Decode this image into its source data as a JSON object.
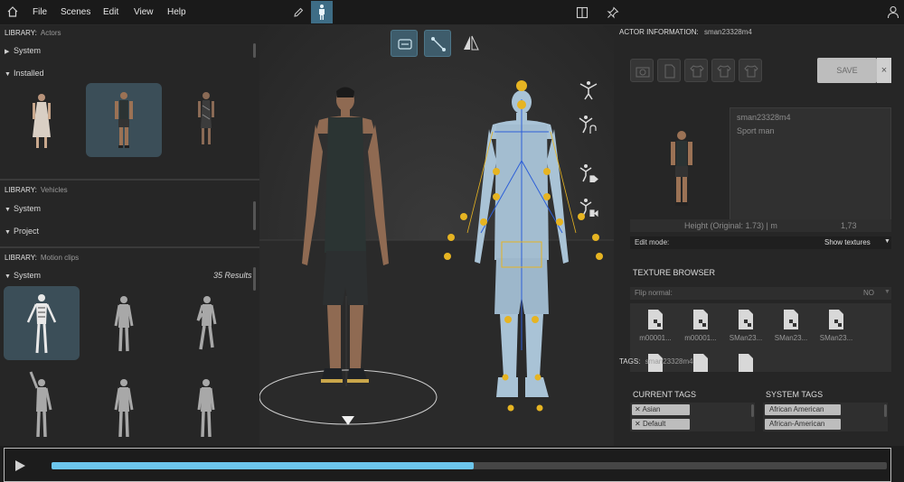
{
  "menubar": {
    "items": [
      "File",
      "Scenes",
      "Edit",
      "View",
      "Help"
    ]
  },
  "left": {
    "actors": {
      "library_label": "LIBRARY:",
      "category": "Actors",
      "rows": [
        "System",
        "Installed"
      ]
    },
    "vehicles": {
      "library_label": "LIBRARY:",
      "category": "Vehicles",
      "rows": [
        "System",
        "Project"
      ]
    },
    "motion": {
      "library_label": "LIBRARY:",
      "category": "Motion clips",
      "rows": [
        "System"
      ],
      "results": "35 Results"
    }
  },
  "right": {
    "actor_info_label": "ACTOR INFORMATION:",
    "actor_id": "sman23328m4",
    "save_label": "SAVE",
    "close_label": "×",
    "info_name": "sman23328m4",
    "info_desc": "Sport man",
    "height_label": "Height (Original: 1.73) | m",
    "height_value": "1,73",
    "edit_mode_label": "Edit mode:",
    "edit_mode_value": "Show textures",
    "texture_browser_label": "TEXTURE BROWSER",
    "flip_normal_label": "Flip normal:",
    "flip_normal_value": "NO",
    "textures": [
      "m00001...",
      "m00001...",
      "SMan23...",
      "SMan23...",
      "SMan23..."
    ],
    "tags_label": "TAGS:",
    "tags_value": "sman23328m4",
    "current_tags_label": "CURRENT TAGS",
    "system_tags_label": "SYSTEM TAGS",
    "current_tags": [
      "Asian",
      "Default"
    ],
    "system_tags": [
      "African American",
      "African-American"
    ]
  },
  "timeline": {
    "progress": 0.505,
    "accent": "#6cc6ec"
  }
}
